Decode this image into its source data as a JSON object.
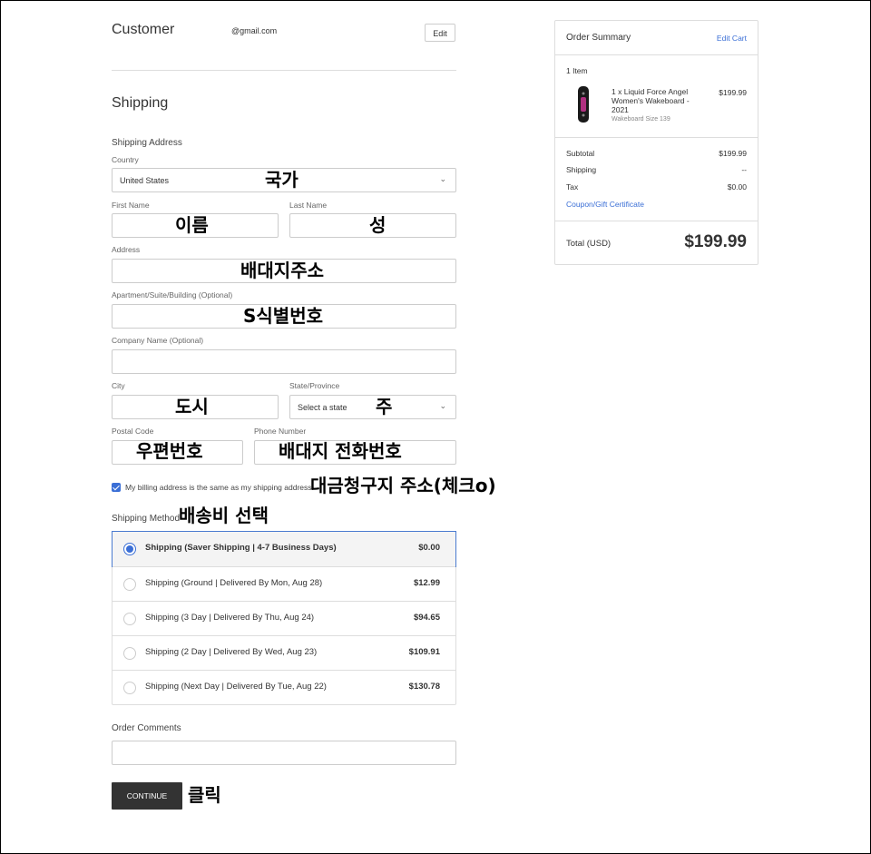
{
  "customer": {
    "title": "Customer",
    "email": "@gmail.com",
    "edit_label": "Edit"
  },
  "shipping": {
    "title": "Shipping",
    "address_heading": "Shipping Address",
    "country": {
      "label": "Country",
      "value": "United States"
    },
    "first_name": {
      "label": "First Name",
      "value": ""
    },
    "last_name": {
      "label": "Last Name",
      "value": ""
    },
    "address": {
      "label": "Address",
      "value": ""
    },
    "apartment": {
      "label": "Apartment/Suite/Building (Optional)",
      "value": ""
    },
    "company": {
      "label": "Company Name (Optional)",
      "value": ""
    },
    "city": {
      "label": "City",
      "value": ""
    },
    "state": {
      "label": "State/Province",
      "value": "Select a state"
    },
    "postal": {
      "label": "Postal Code",
      "value": ""
    },
    "phone": {
      "label": "Phone Number",
      "value": ""
    },
    "billing_same_label": "My billing address is the same as my shipping address.",
    "billing_same_checked": true,
    "method_heading": "Shipping Method",
    "methods": [
      {
        "label": "Shipping (Saver Shipping | 4-7 Business Days)",
        "price": "$0.00",
        "selected": true
      },
      {
        "label": "Shipping (Ground | Delivered By Mon, Aug 28)",
        "price": "$12.99",
        "selected": false
      },
      {
        "label": "Shipping (3 Day | Delivered By Thu, Aug 24)",
        "price": "$94.65",
        "selected": false
      },
      {
        "label": "Shipping (2 Day | Delivered By Wed, Aug 23)",
        "price": "$109.91",
        "selected": false
      },
      {
        "label": "Shipping (Next Day | Delivered By Tue, Aug 22)",
        "price": "$130.78",
        "selected": false
      }
    ],
    "comments_label": "Order Comments",
    "comments_value": "",
    "continue_label": "CONTINUE"
  },
  "annotations": {
    "country": "국가",
    "first_name": "이름",
    "last_name": "성",
    "address": "배대지주소",
    "apartment": "S식별번호",
    "city": "도시",
    "state": "주",
    "postal": "우편번호",
    "phone": "배대지 전화번호",
    "billing": "대금청구지 주소(체크o)",
    "method": "배송비 선택",
    "continue": "클릭"
  },
  "summary": {
    "title": "Order Summary",
    "edit_cart": "Edit Cart",
    "item_count": "1 Item",
    "item": {
      "name": "1 x Liquid Force Angel Women's Wakeboard - 2021",
      "option": "Wakeboard Size 139",
      "price": "$199.99"
    },
    "subtotal_label": "Subtotal",
    "subtotal": "$199.99",
    "shipping_label": "Shipping",
    "shipping": "--",
    "tax_label": "Tax",
    "tax": "$0.00",
    "coupon_label": "Coupon/Gift Certificate",
    "total_label": "Total (USD)",
    "total": "$199.99"
  },
  "colors": {
    "accent": "#3b6fd6",
    "button": "#333333",
    "border": "#cccccc"
  }
}
